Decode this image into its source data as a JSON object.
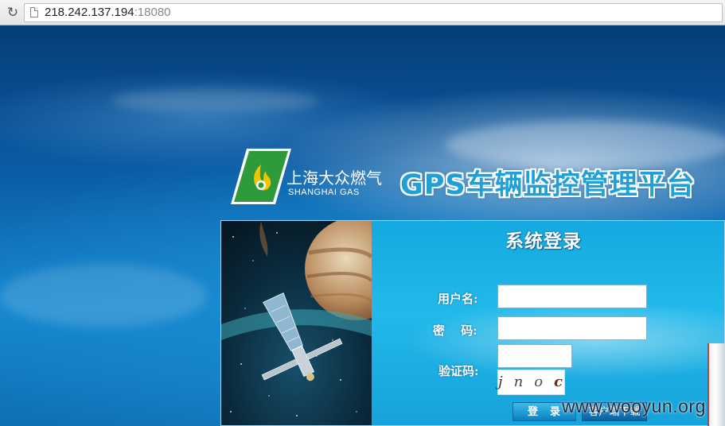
{
  "browser": {
    "url_host": "218.242.137.194",
    "url_port": ":18080"
  },
  "header": {
    "company_cn": "上海大众燃气",
    "company_en": "SHANGHAI GAS",
    "platform_title": "GPS车辆监控管理平台"
  },
  "login": {
    "title": "系统登录",
    "username_label": "用户名:",
    "password_label": "密　 码:",
    "captcha_label": "验证码:",
    "username_value": "",
    "password_value": "",
    "captcha_value": "",
    "captcha_chars": [
      "j",
      "n",
      "o",
      "c"
    ],
    "login_button": "登　录",
    "download_button": "客户端下载"
  },
  "watermark": "www.wooyun.org",
  "colors": {
    "background": "#0a5aa3",
    "form_bg": "#22b9ea",
    "title_blue": "#1fa0d8",
    "logo_green": "#2f9a3a",
    "logo_yellow": "#f2c400"
  },
  "icons": [
    "reload-icon",
    "page-icon",
    "shanghai-gas-logo-icon",
    "satellite-illustration"
  ]
}
